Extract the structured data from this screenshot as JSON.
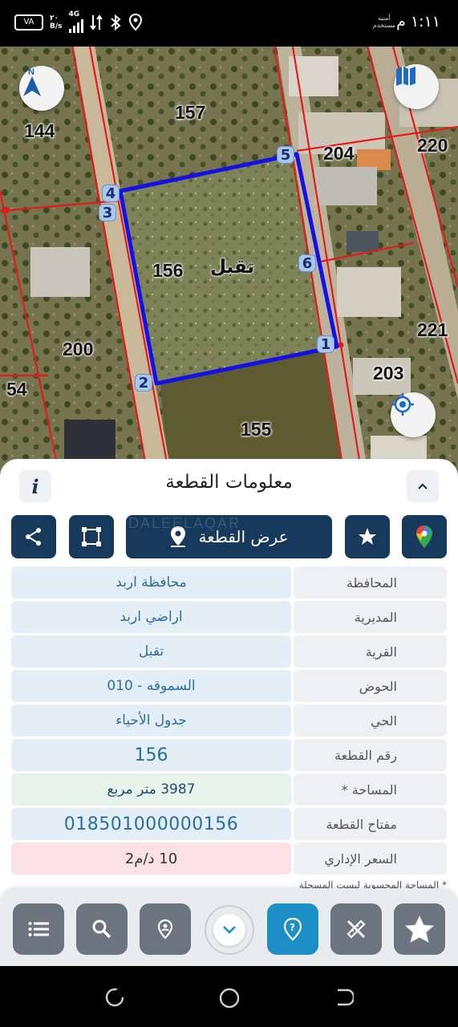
{
  "status_bar": {
    "time": "١:١١ م",
    "carrier_line1": "أمنيه",
    "carrier_line2": "مستخدم",
    "battery": "VA",
    "net_speed_value": "٢٠",
    "net_speed_unit": "B/s",
    "network_type": "4G"
  },
  "map": {
    "plot_labels": [
      "144",
      "157",
      "204",
      "220",
      "156",
      "200",
      "221",
      "203",
      "54",
      "155"
    ],
    "village_label": "تقبل",
    "vertices": [
      "1",
      "2",
      "3",
      "4",
      "5",
      "6"
    ],
    "colors": {
      "boundary": "#e31b1b",
      "parcel": "#1410e6"
    },
    "icons": {
      "compass": "north-arrow-icon",
      "layers": "map-layers-icon",
      "locate": "my-location-icon"
    },
    "compass_letter": "N"
  },
  "panel": {
    "title": "معلومات القطعة",
    "info_glyph": "i",
    "show_parcel_label": "عرض القطعة",
    "watermark": "DALEELAQAR",
    "rows": [
      {
        "label": "المحافظة",
        "value": "محافظة اربد"
      },
      {
        "label": "المديرية",
        "value": "اراضي اربد"
      },
      {
        "label": "القرية",
        "value": "تقبل"
      },
      {
        "label": "الحوض",
        "value": "السموقه - 010"
      },
      {
        "label": "الحي",
        "value": "جدول الأحياء"
      },
      {
        "label": "رقم القطعة",
        "value": "156"
      },
      {
        "label": "المساحة *",
        "value": "3987  متر مربع"
      },
      {
        "label": "مفتاح القطعة",
        "value": "018501000000156"
      },
      {
        "label": "السعر الإداري",
        "value": "10 د/م2"
      }
    ],
    "footnote": "* المساحة المحسوبة ليست المسجلة"
  },
  "toolbar": {
    "items": [
      "list-icon",
      "search-icon",
      "location-pin-icon",
      "chevron-down-icon",
      "help-pin-icon",
      "measure-tools-icon",
      "favorites-star-icon"
    ]
  }
}
